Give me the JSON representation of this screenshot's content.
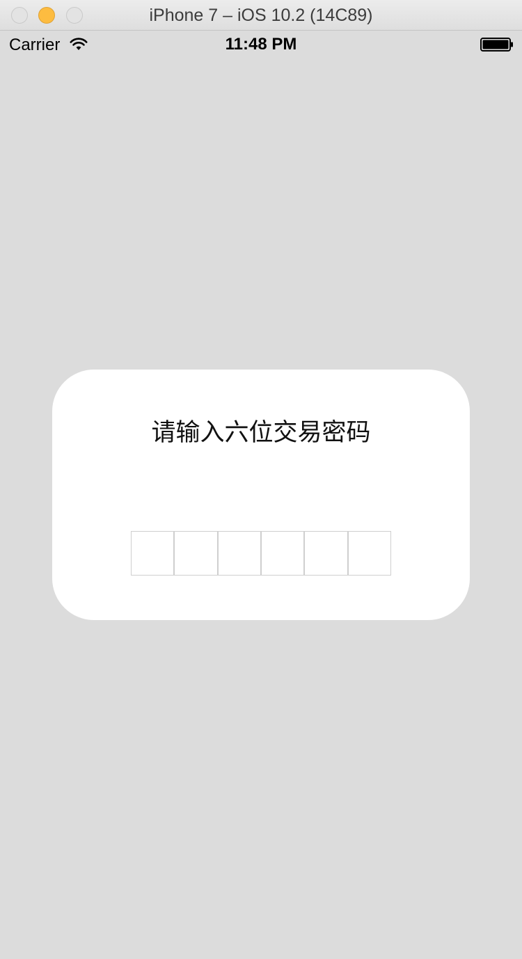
{
  "window": {
    "title": "iPhone 7 – iOS 10.2 (14C89)"
  },
  "status_bar": {
    "carrier": "Carrier",
    "time": "11:48 PM",
    "icons": [
      "wifi-icon",
      "battery-icon"
    ]
  },
  "dialog": {
    "title": "请输入六位交易密码",
    "pin_length": 6,
    "pin_values": [
      "",
      "",
      "",
      "",
      "",
      ""
    ]
  },
  "colors": {
    "background": "#dcdcdc",
    "dialog_background": "#ffffff",
    "pin_border": "#cfcfcf",
    "minimize_button": "#fdbc40"
  }
}
